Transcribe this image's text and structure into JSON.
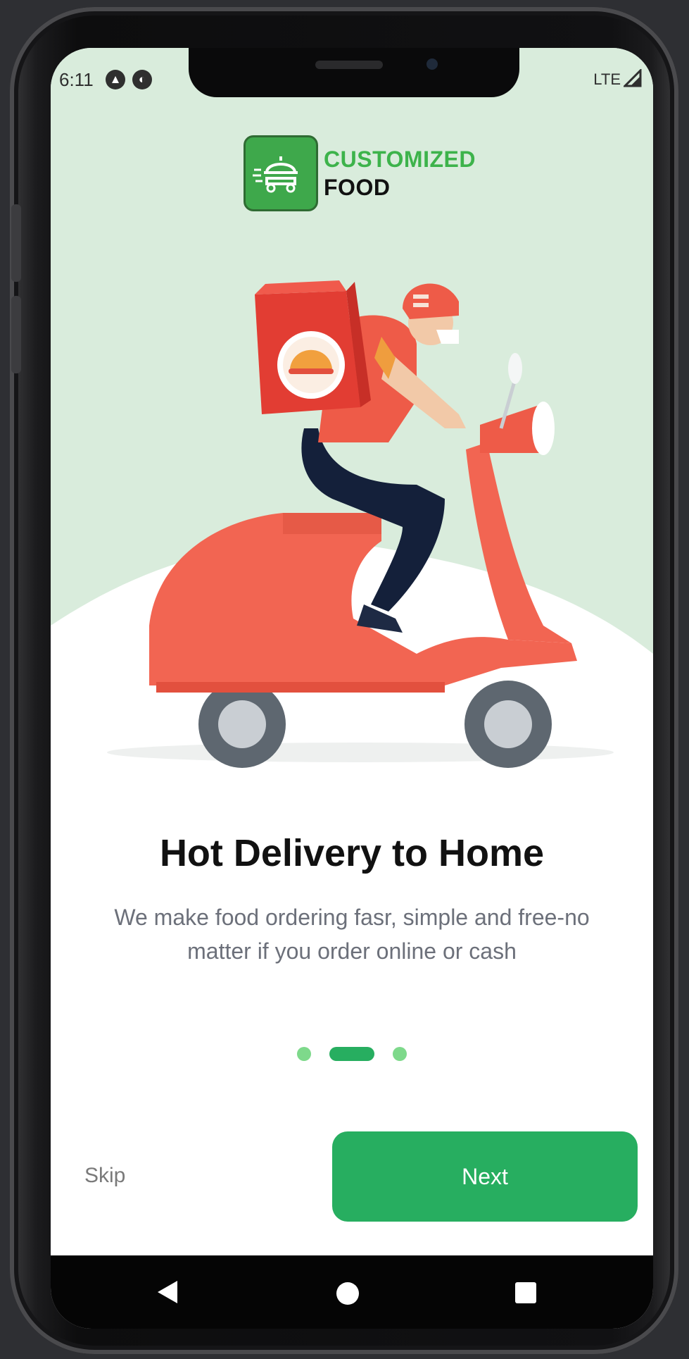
{
  "status_bar": {
    "time": "6:11",
    "network": "LTE"
  },
  "brand": {
    "line1": "CUSTOMIZED",
    "line2": "FOOD"
  },
  "onboarding": {
    "title": "Hot Delivery to Home",
    "subtitle": "We make food ordering fasr, simple and free-no matter if you order online or cash",
    "page_indicator": {
      "current": 2,
      "total": 3
    }
  },
  "actions": {
    "skip_label": "Skip",
    "next_label": "Next"
  },
  "colors": {
    "primary_green": "#27ae60",
    "brand_green": "#3db34b",
    "scene_background": "#d9ecdc",
    "scooter_red": "#f26552"
  },
  "icons": {
    "status": [
      "a-notification-icon",
      "p-notification-icon",
      "signal-icon"
    ],
    "logo": "delivery-scooter-icon",
    "navigation": [
      "back-icon",
      "home-icon",
      "recents-icon"
    ]
  }
}
